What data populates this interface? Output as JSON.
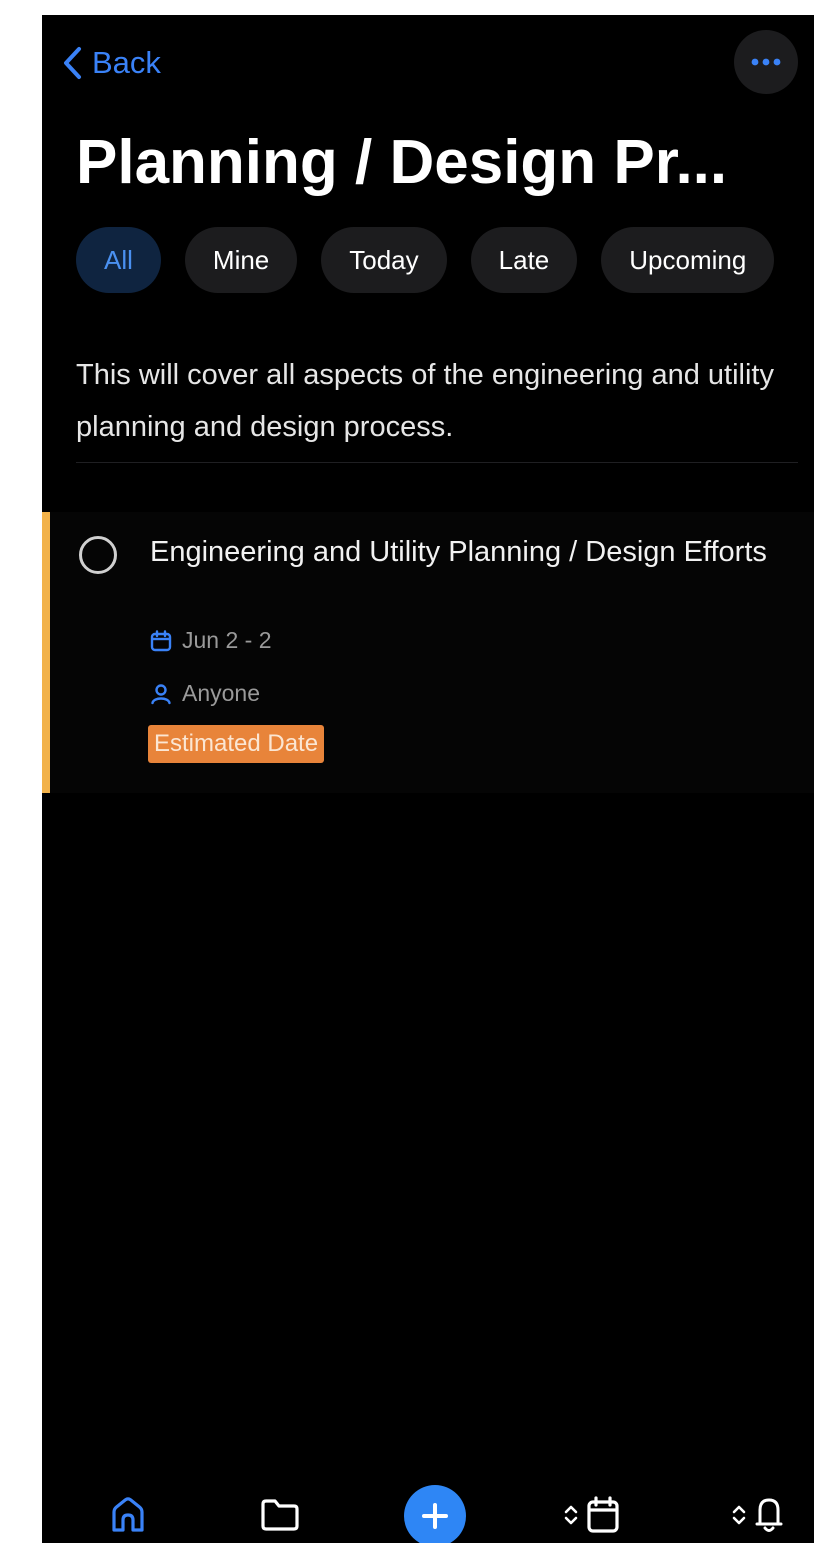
{
  "header": {
    "back_label": "Back",
    "title": "Planning / Design Pr..."
  },
  "filters": [
    {
      "label": "All",
      "active": true
    },
    {
      "label": "Mine",
      "active": false
    },
    {
      "label": "Today",
      "active": false
    },
    {
      "label": "Late",
      "active": false
    },
    {
      "label": "Upcoming",
      "active": false
    }
  ],
  "description": "This will cover all aspects of the engineering and utility planning and design process.",
  "tasks": [
    {
      "title": "Engineering and Utility Planning / Design Efforts",
      "date": "Jun 2 - 2",
      "assignee": "Anyone",
      "badge": "Estimated Date",
      "completed": false
    }
  ],
  "colors": {
    "accent": "#3a82f7",
    "task_bar": "#f2b24a",
    "badge": "#e8843a",
    "background": "#000000"
  },
  "tabbar": {
    "icons": [
      "home-icon",
      "folder-icon",
      "add-icon",
      "calendar-icon",
      "bell-icon"
    ]
  }
}
